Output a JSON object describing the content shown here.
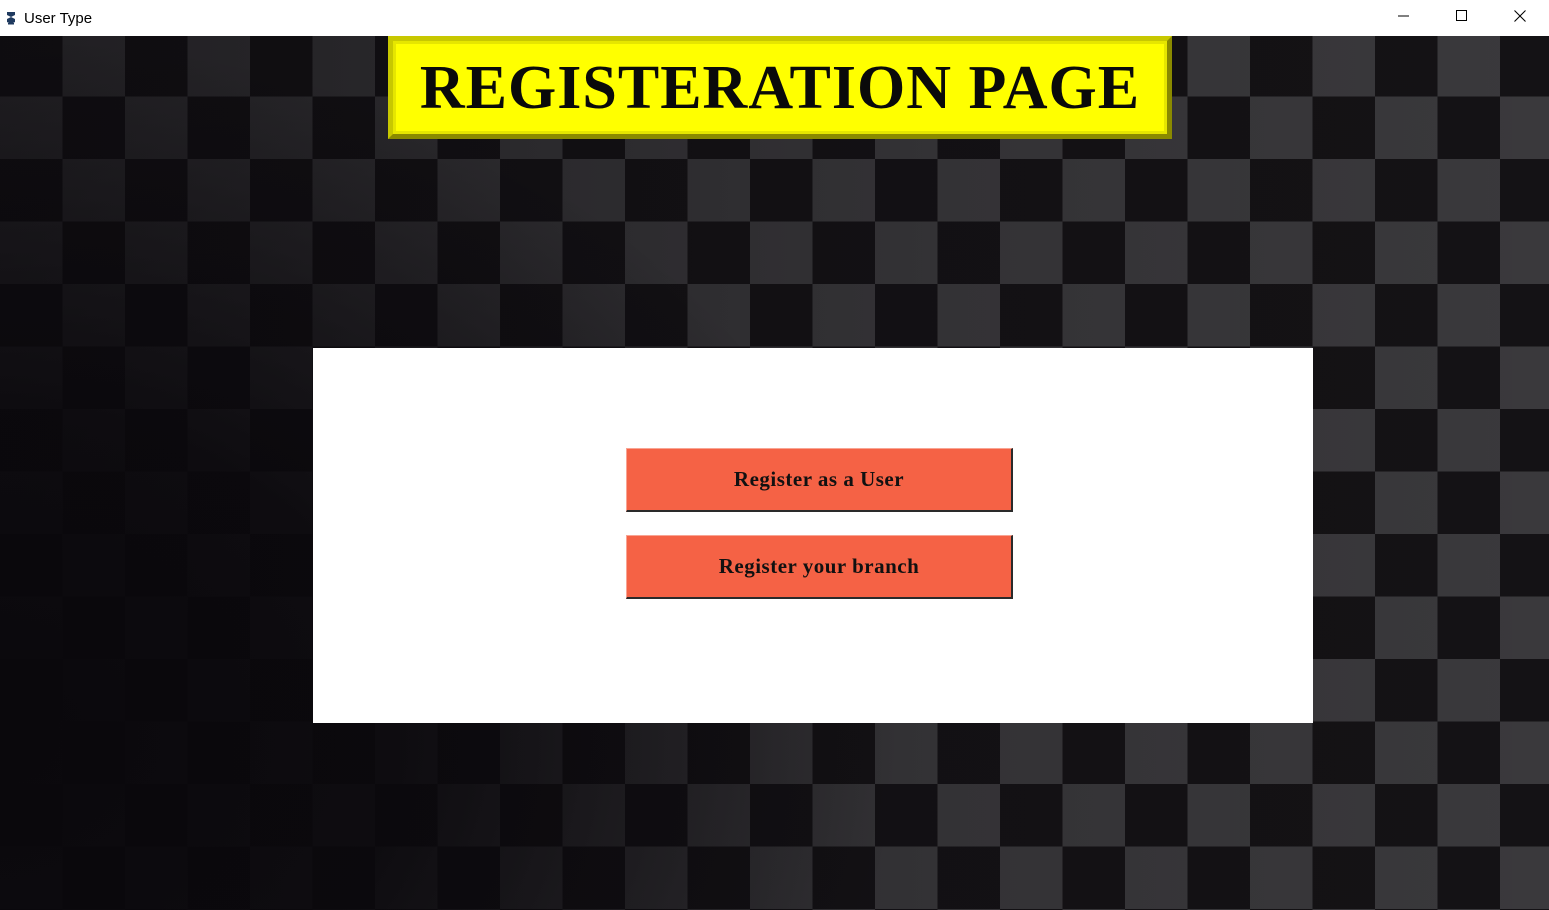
{
  "window": {
    "title": "User Type",
    "app_icon": "python-feather-icon",
    "controls": {
      "minimize_icon": "minimize-icon",
      "maximize_icon": "maximize-icon",
      "close_icon": "close-icon"
    }
  },
  "banner": {
    "text": "REGISTERATION PAGE",
    "background_color": "#ffff00"
  },
  "panel": {
    "buttons": [
      {
        "label": "Register as a User"
      },
      {
        "label": "Register your branch"
      }
    ],
    "button_color": "#f56245"
  }
}
